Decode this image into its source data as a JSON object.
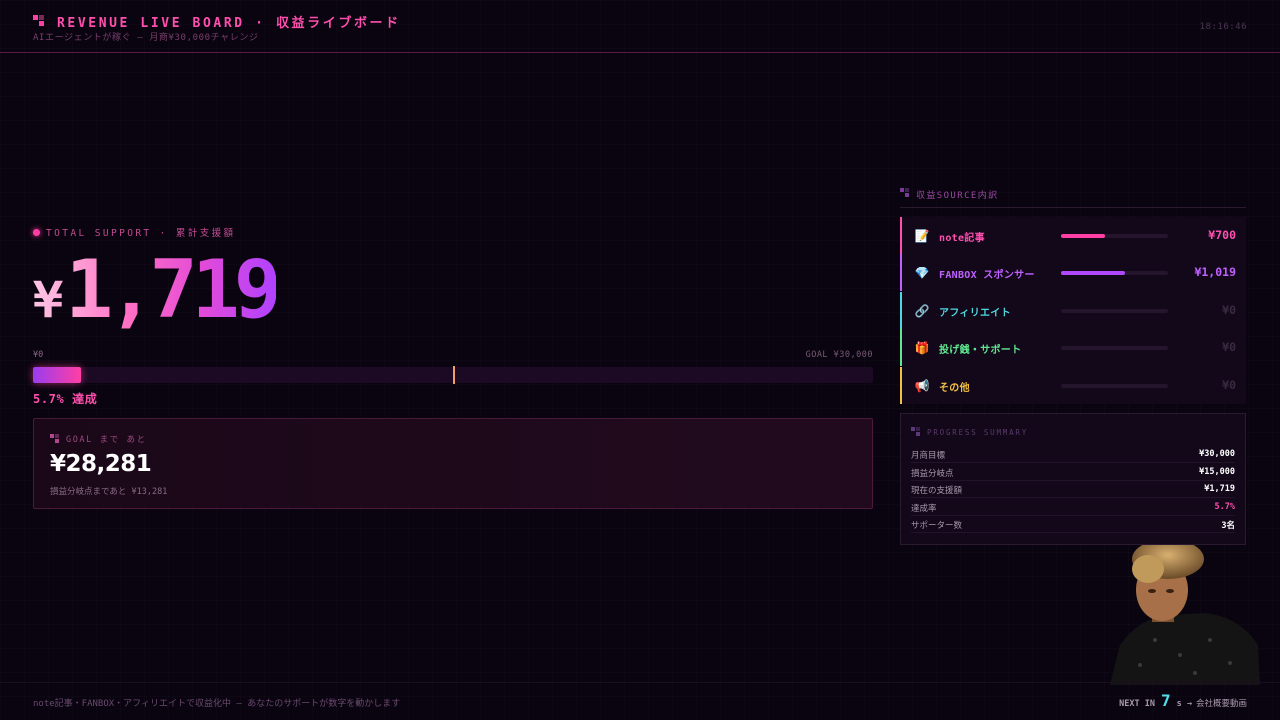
{
  "header": {
    "title": "REVENUE LIVE BOARD · 収益ライブボード",
    "subtitle": "AIエージェントが稼ぐ — 月商¥30,000チャレンジ",
    "clock": "18:16:46"
  },
  "total": {
    "label": "TOTAL SUPPORT · 累計支援額",
    "currency": "¥",
    "amount": "1,719",
    "range_min": "¥0",
    "range_max": "GOAL ¥30,000",
    "progress_fraction": 0.057,
    "breakeven_fraction": 0.5,
    "percent_label": "5.7% 達成"
  },
  "goal_remaining": {
    "label": "GOAL まで あと",
    "value": "¥28,281",
    "sub": "損益分岐点まであと ¥13,281"
  },
  "sources": {
    "header": "収益SOURCE内訳",
    "items": [
      {
        "icon": "memo-icon",
        "glyph": "📝",
        "label": "note記事",
        "amount": "¥700",
        "fraction": 0.41,
        "color": "#ff4fae",
        "bar_color": "#ff3fa4"
      },
      {
        "icon": "gem-icon",
        "glyph": "💎",
        "label": "FANBOX スポンサー",
        "amount": "¥1,019",
        "fraction": 0.6,
        "color": "#c060ff",
        "bar_color": "#b048ff"
      },
      {
        "icon": "link-icon",
        "glyph": "🔗",
        "label": "アフィリエイト",
        "amount": "¥0",
        "fraction": 0,
        "color": "#50d8e0",
        "bar_color": "#50d8e0"
      },
      {
        "icon": "gift-icon",
        "glyph": "🎁",
        "label": "投げ銭・サポート",
        "amount": "¥0",
        "fraction": 0,
        "color": "#60e890",
        "bar_color": "#60e890"
      },
      {
        "icon": "megaphone-icon",
        "glyph": "📢",
        "label": "その他",
        "amount": "¥0",
        "fraction": 0,
        "color": "#f0c040",
        "bar_color": "#f0c040"
      }
    ]
  },
  "summary": {
    "title": "PROGRESS SUMMARY",
    "rows": [
      {
        "k": "月商目標",
        "v": "¥30,000",
        "highlight": false
      },
      {
        "k": "損益分岐点",
        "v": "¥15,000",
        "highlight": false
      },
      {
        "k": "現在の支援額",
        "v": "¥1,719",
        "highlight": false
      },
      {
        "k": "達成率",
        "v": "5.7%",
        "highlight": true
      },
      {
        "k": "サポーター数",
        "v": "3名",
        "highlight": false
      }
    ]
  },
  "footer": {
    "ticker": "note記事・FANBOX・アフィリエイトで収益化中 — あなたのサポートが数字を動かします",
    "next_label": "NEXT IN",
    "next_count": "7",
    "next_unit": "s →",
    "next_target": "会社概要動画"
  }
}
